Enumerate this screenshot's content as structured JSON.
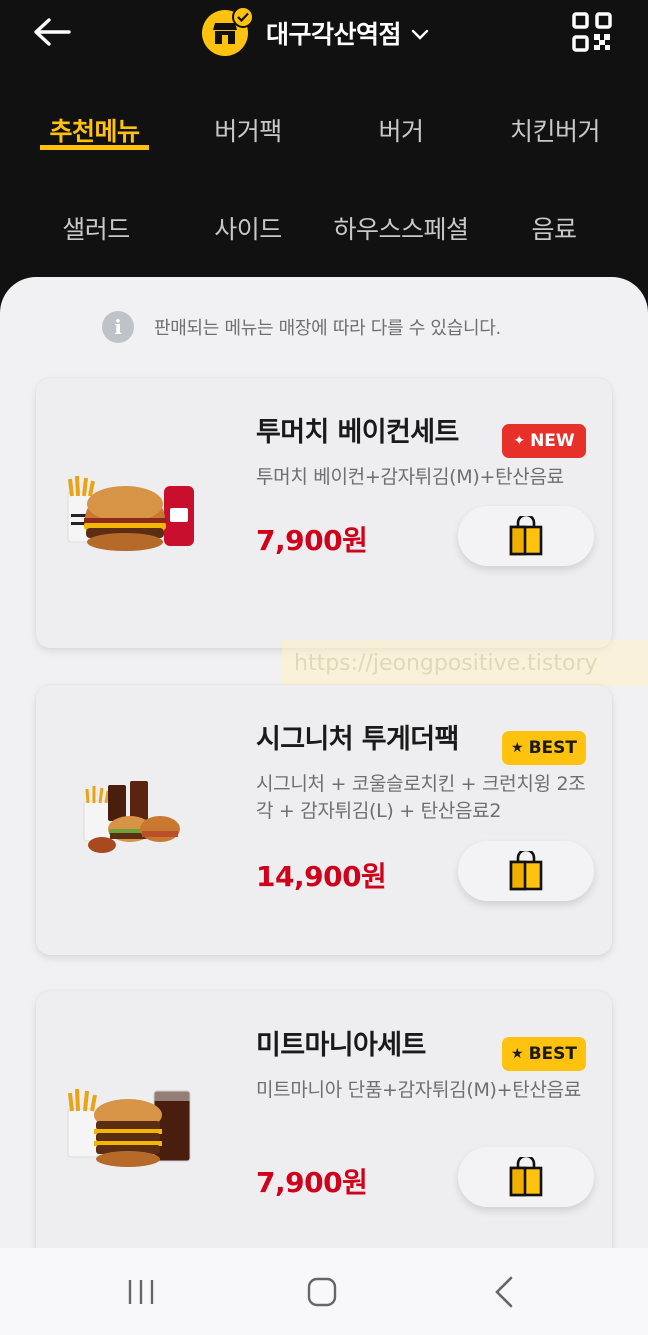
{
  "header": {
    "store_name": "대구각산역점",
    "back_icon": "arrow-left-icon",
    "store_icon": "store-icon",
    "qr_icon": "qr-code-icon"
  },
  "tabs": [
    {
      "label": "추천메뉴",
      "active": true
    },
    {
      "label": "버거팩",
      "active": false
    },
    {
      "label": "버거",
      "active": false
    },
    {
      "label": "치킨버거",
      "active": false
    },
    {
      "label": "샐러드",
      "active": false
    },
    {
      "label": "사이드",
      "active": false
    },
    {
      "label": "하우스스페셜",
      "active": false
    },
    {
      "label": "음료",
      "active": false
    }
  ],
  "notice": "판매되는 메뉴는 매장에 따라 다를 수 있습니다.",
  "menu_items": [
    {
      "name": "투머치 베이컨세트",
      "badge": "NEW",
      "description": "투머치 베이컨+감자튀김(M)+탄산음료",
      "price": "7,900원"
    },
    {
      "name": "시그니처 투게더팩",
      "badge": "BEST",
      "description": "시그니처 + 코울슬로치킨 + 크런치윙 2조각 + 감자튀김(L) + 탄산음료2",
      "price": "14,900원"
    },
    {
      "name": "미트마니아세트",
      "badge": "BEST",
      "description": "미트마니아 단품+감자튀김(M)+탄산음료",
      "price": "7,900원"
    }
  ],
  "watermark_text": "https://jeongpositive.tistory",
  "colors": {
    "accent": "#FFC20E",
    "price": "#D0021B",
    "new_badge": "#E8302A",
    "header_bg": "#111112",
    "sheet_bg": "#F1F1F3"
  }
}
